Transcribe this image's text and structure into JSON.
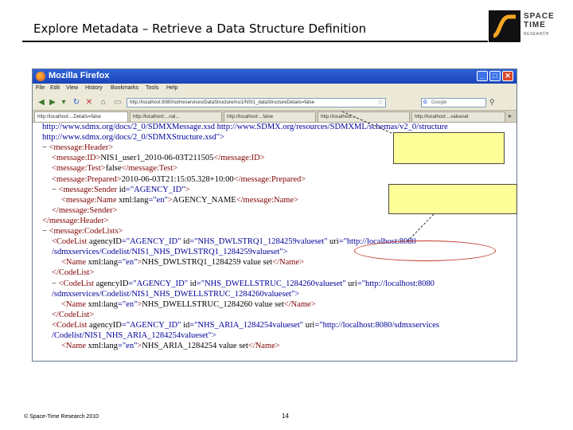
{
  "slide": {
    "title": "Explore Metadata – Retrieve a Data Structure Definition",
    "footer_copyright": "© Space-Time Research 2010",
    "page_number": "14"
  },
  "logo": {
    "line1": "SPACE",
    "line2": "TIME",
    "line3": "RESEARCH"
  },
  "browser": {
    "window_title": "Mozilla Firefox",
    "menu": [
      "File",
      "Edit",
      "View",
      "History",
      "Bookmarks",
      "Tools",
      "Help"
    ],
    "url": "http://localhost:8080/sdmxservices/DataStructure/nsi1/NSI1_dataStructureDetails=false",
    "search_engine": "Google",
    "tabs": [
      "http://localhost:...Details=false",
      "http://localhost:...nal...",
      "http://localhost:...false",
      "http://localhost:...",
      "http://localhost:...valueset"
    ],
    "lines": [
      {
        "parts": [
          {
            "t": "http://www.sdmx.org/docs/2_0/SDMXMessage.xsd http://www.SDMX.org/resources/SDMXML/schemas/v2_0/structure",
            "c": "av"
          }
        ]
      },
      {
        "parts": [
          {
            "t": "http://www.sdmx.org/docs/2_0/SDMXStructure.xsd\">",
            "c": "av"
          }
        ]
      },
      {
        "parts": [
          {
            "t": "− ",
            "c": "at"
          },
          {
            "t": "<message:Header>",
            "c": "tg"
          }
        ]
      },
      {
        "parts": [
          {
            "t": "<message:ID>",
            "c": "tg"
          },
          {
            "t": "NIS1_user1_2010-06-03T211505",
            "c": "at"
          },
          {
            "t": "</message:ID>",
            "c": "tg"
          }
        ]
      },
      {
        "parts": [
          {
            "t": "<message:Test>",
            "c": "tg"
          },
          {
            "t": "false",
            "c": "at"
          },
          {
            "t": "</message:Test>",
            "c": "tg"
          }
        ]
      },
      {
        "parts": [
          {
            "t": "<message:Prepared>",
            "c": "tg"
          },
          {
            "t": "2010-06-03T21:15:05.328+10:00",
            "c": "at"
          },
          {
            "t": "</message:Prepared>",
            "c": "tg"
          }
        ]
      },
      {
        "parts": [
          {
            "t": "− ",
            "c": "at"
          },
          {
            "t": "<message:Sender ",
            "c": "tg"
          },
          {
            "t": "id",
            "c": "at"
          },
          {
            "t": "=\"AGENCY_ID\"",
            "c": "av"
          },
          {
            "t": ">",
            "c": "tg"
          }
        ]
      },
      {
        "parts": [
          {
            "t": "<message:Name ",
            "c": "tg"
          },
          {
            "t": "xml:lang",
            "c": "at"
          },
          {
            "t": "=\"en\"",
            "c": "av"
          },
          {
            "t": ">",
            "c": "tg"
          },
          {
            "t": "AGENCY_NAME",
            "c": "at"
          },
          {
            "t": "</message:Name>",
            "c": "tg"
          }
        ]
      },
      {
        "parts": [
          {
            "t": "</message:Sender>",
            "c": "tg"
          }
        ]
      },
      {
        "parts": [
          {
            "t": "</message:Header>",
            "c": "tg"
          }
        ]
      },
      {
        "parts": [
          {
            "t": "− ",
            "c": "at"
          },
          {
            "t": "<message:CodeLists>",
            "c": "tg"
          }
        ]
      },
      {
        "parts": [
          {
            "t": "<CodeList ",
            "c": "tg"
          },
          {
            "t": "agencyID",
            "c": "at"
          },
          {
            "t": "=\"AGENCY_ID\" ",
            "c": "av"
          },
          {
            "t": "id",
            "c": "at"
          },
          {
            "t": "=\"NHS_DWLSTRQ1_1284259valueset\" ",
            "c": "av"
          },
          {
            "t": "uri",
            "c": "at"
          },
          {
            "t": "=\"http://localhost:8080",
            "c": "av"
          }
        ]
      },
      {
        "parts": [
          {
            "t": "/sdmxservices/Codelist/NIS1_NHS_DWLSTRQ1_1284259valueset\">",
            "c": "av"
          }
        ]
      },
      {
        "parts": [
          {
            "t": "<Name ",
            "c": "tg"
          },
          {
            "t": "xml:lang",
            "c": "at"
          },
          {
            "t": "=\"en\"",
            "c": "av"
          },
          {
            "t": ">",
            "c": "tg"
          },
          {
            "t": "NHS_DWLSTRQ1_1284259 value set",
            "c": "at"
          },
          {
            "t": "</Name>",
            "c": "tg"
          }
        ]
      },
      {
        "parts": [
          {
            "t": "</CodeList>",
            "c": "tg"
          }
        ]
      },
      {
        "parts": [
          {
            "t": "− ",
            "c": "at"
          },
          {
            "t": "<CodeList ",
            "c": "tg"
          },
          {
            "t": "agencyID",
            "c": "at"
          },
          {
            "t": "=\"AGENCY_ID\" ",
            "c": "av"
          },
          {
            "t": "id",
            "c": "at"
          },
          {
            "t": "=\"NHS_DWELLSTRUC_1284260valueset\" ",
            "c": "av"
          },
          {
            "t": "uri",
            "c": "at"
          },
          {
            "t": "=\"http://localhost:8080",
            "c": "av"
          }
        ]
      },
      {
        "parts": [
          {
            "t": "/sdmxservices/Codelist/NIS1_NHS_DWELLSTRUC_1284260valueset\">",
            "c": "av"
          }
        ]
      },
      {
        "parts": [
          {
            "t": "<Name ",
            "c": "tg"
          },
          {
            "t": "xml:lang",
            "c": "at"
          },
          {
            "t": "=\"en\"",
            "c": "av"
          },
          {
            "t": ">",
            "c": "tg"
          },
          {
            "t": "NHS_DWELLSTRUC_1284260 value set",
            "c": "at"
          },
          {
            "t": "</Name>",
            "c": "tg"
          }
        ]
      },
      {
        "parts": [
          {
            "t": "</CodeList>",
            "c": "tg"
          }
        ]
      },
      {
        "parts": [
          {
            "t": "<CodeList ",
            "c": "tg"
          },
          {
            "t": "agencyID",
            "c": "at"
          },
          {
            "t": "=\"AGENCY_ID\" ",
            "c": "av"
          },
          {
            "t": "id",
            "c": "at"
          },
          {
            "t": "=\"NHS_ARIA_1284254valueset\" ",
            "c": "av"
          },
          {
            "t": "uri",
            "c": "at"
          },
          {
            "t": "=\"http://localhost:8080/sdmxservices",
            "c": "av"
          }
        ]
      },
      {
        "parts": [
          {
            "t": "/Codelist/NIS1_NHS_ARIA_1284254valueset\">",
            "c": "av"
          }
        ]
      },
      {
        "parts": [
          {
            "t": "<Name ",
            "c": "tg"
          },
          {
            "t": "xml:lang",
            "c": "at"
          },
          {
            "t": "=\"en\"",
            "c": "av"
          },
          {
            "t": ">",
            "c": "tg"
          },
          {
            "t": "NHS_ARIA_1284254 value set",
            "c": "at"
          },
          {
            "t": "</Name>",
            "c": "tg"
          }
        ]
      }
    ]
  },
  "colors": {
    "tag": "#800000",
    "attr_value": "#00009a",
    "callout_fill": "#ffff99",
    "highlight_oval": "#c0392b",
    "titlebar": "#2f63d8"
  }
}
